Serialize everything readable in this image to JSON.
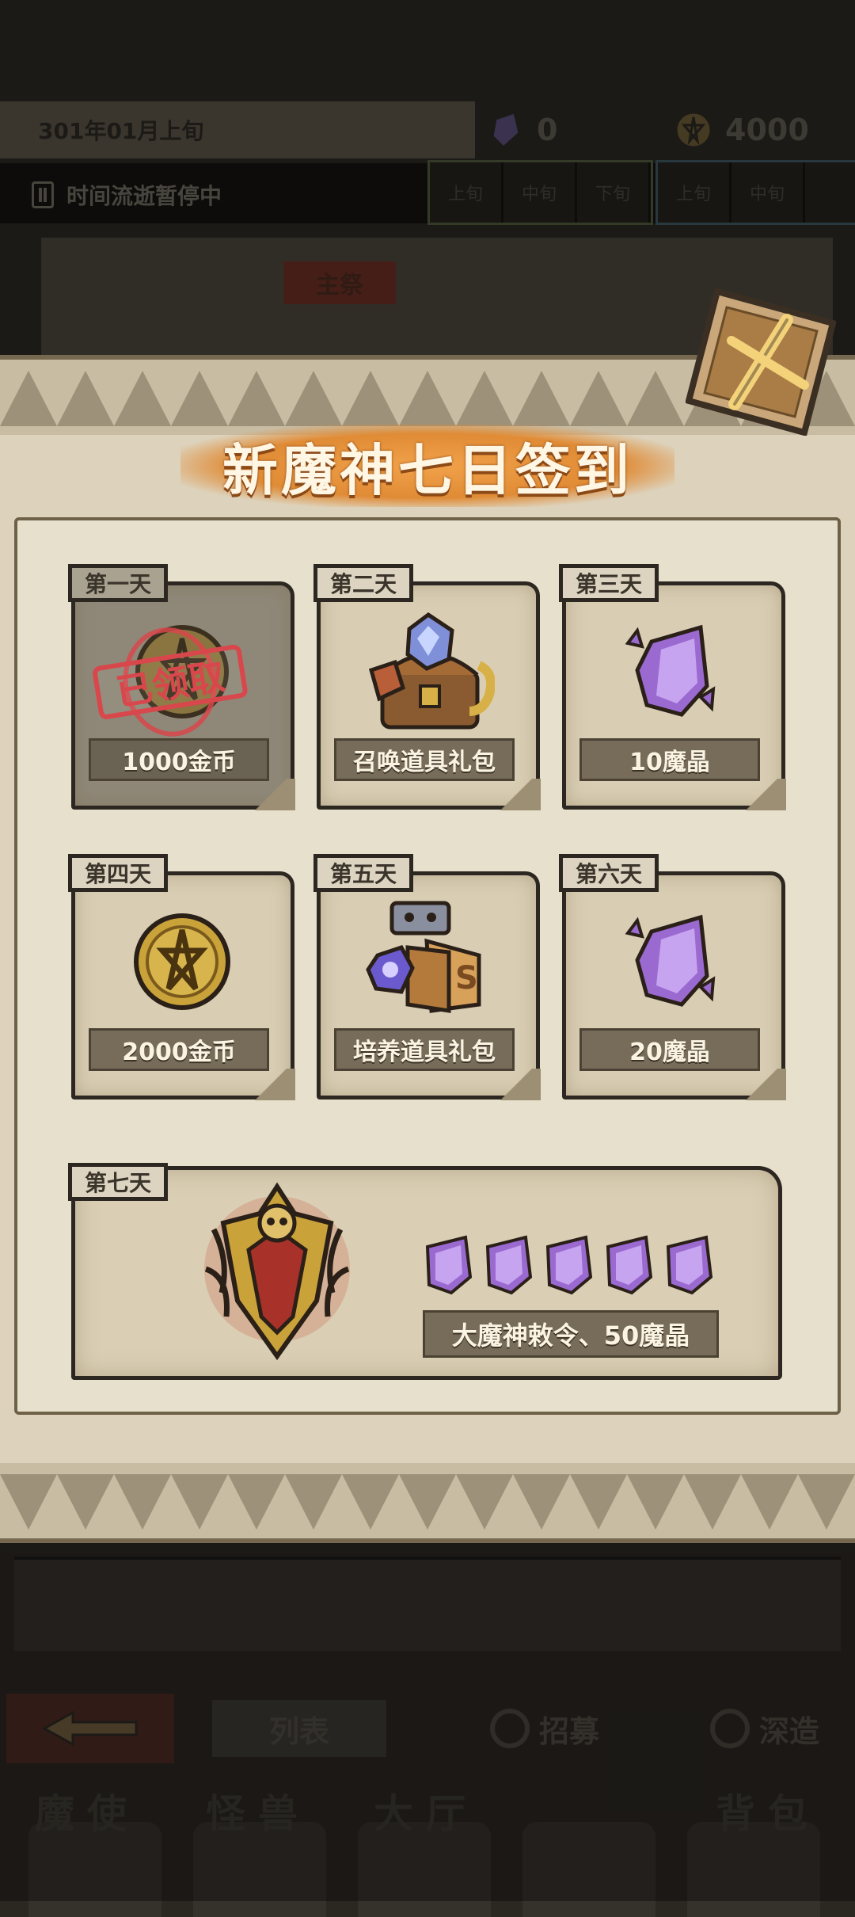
{
  "background": {
    "date_text": "301年01月上旬",
    "crystal_count": "0",
    "gold_count": "4000",
    "pause_text": "时间流逝暂停中",
    "time_segments_a": [
      "上旬",
      "中旬",
      "下旬"
    ],
    "time_segments_b": [
      "上旬",
      "中旬",
      ""
    ],
    "main_tag": "主祭",
    "menu": {
      "list": "列表",
      "recruit": "招募",
      "deep": "深造"
    },
    "tabs": [
      "魔使",
      "怪兽",
      "大厅",
      "",
      "背包"
    ]
  },
  "modal": {
    "title": "新魔神七日签到",
    "claimed_stamp": "已领取",
    "days": [
      {
        "day": "第一天",
        "reward": "1000金币",
        "claimed": true,
        "icon": "gold-coin-icon"
      },
      {
        "day": "第二天",
        "reward": "召唤道具礼包",
        "claimed": false,
        "icon": "summon-chest-icon"
      },
      {
        "day": "第三天",
        "reward": "10魔晶",
        "claimed": false,
        "icon": "purple-crystal-icon"
      },
      {
        "day": "第四天",
        "reward": "2000金币",
        "claimed": false,
        "icon": "gold-coin-icon"
      },
      {
        "day": "第五天",
        "reward": "培养道具礼包",
        "claimed": false,
        "icon": "training-bundle-icon"
      },
      {
        "day": "第六天",
        "reward": "20魔晶",
        "claimed": false,
        "icon": "purple-crystal-icon"
      }
    ],
    "day7": {
      "day": "第七天",
      "reward": "大魔神敕令、50魔晶",
      "icon": "demon-emblem-icon",
      "crystal_icons": 5
    }
  },
  "colors": {
    "accent_orange": "#e08b35",
    "stamp_red": "#d8474b",
    "crystal_purple": "#9a6ad1",
    "gold": "#c9a23a"
  }
}
